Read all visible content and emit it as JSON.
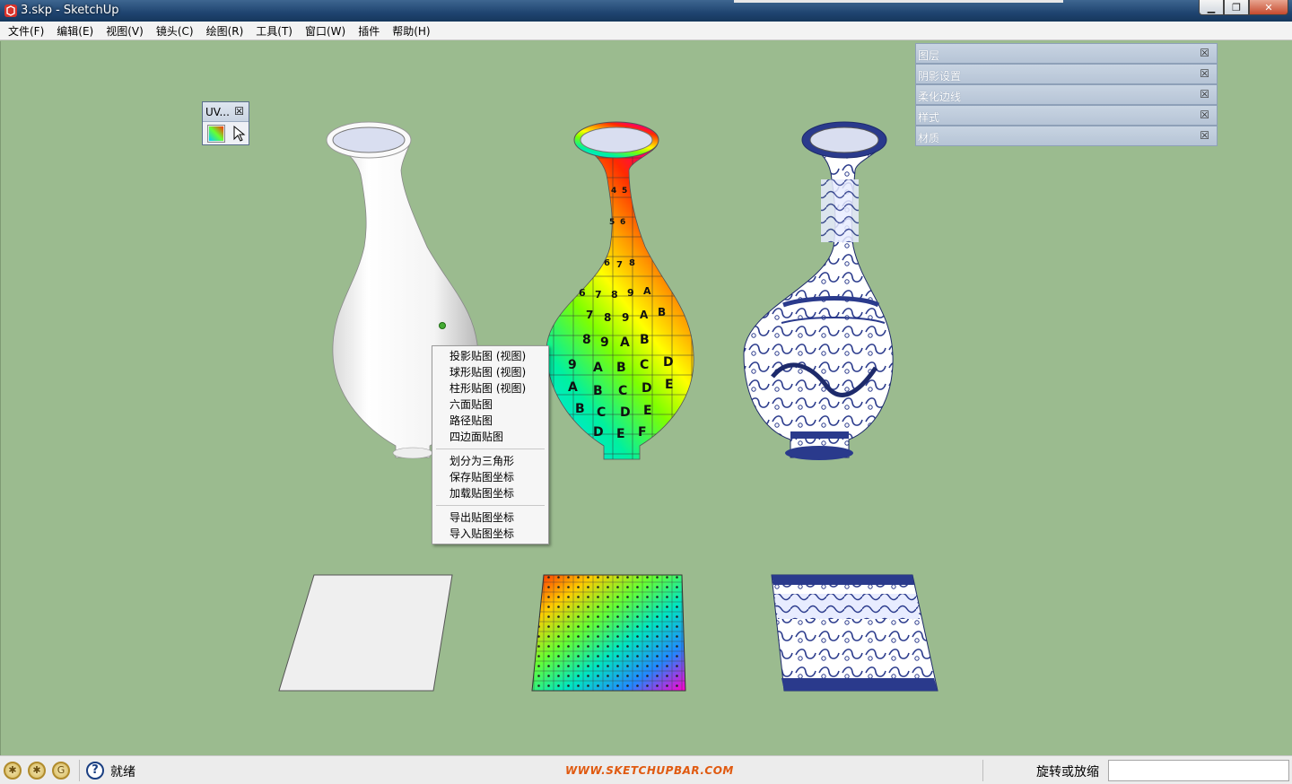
{
  "window": {
    "title": "3.skp - SketchUp",
    "controls": [
      "minimize",
      "maximize",
      "close"
    ]
  },
  "menubar": {
    "items": [
      "文件(F)",
      "编辑(E)",
      "视图(V)",
      "镜头(C)",
      "绘图(R)",
      "工具(T)",
      "窗口(W)",
      "插件",
      "帮助(H)"
    ]
  },
  "uv_toolbar": {
    "title": "UV...",
    "close": "☒",
    "tools": [
      "uv-texture-icon",
      "uv-pointer-icon"
    ]
  },
  "trays": [
    {
      "label": "图层"
    },
    {
      "label": "阴影设置"
    },
    {
      "label": "柔化边线"
    },
    {
      "label": "样式"
    },
    {
      "label": "材质"
    }
  ],
  "context_menu": {
    "group1": [
      "投影贴图 (视图)",
      "球形贴图 (视图)",
      "柱形贴图 (视图)",
      "六面贴图",
      "路径贴图",
      "四边面贴图"
    ],
    "group2": [
      "划分为三角形",
      "保存贴图坐标",
      "加载贴图坐标"
    ],
    "group3": [
      "导出贴图坐标",
      "导入贴图坐标"
    ]
  },
  "scene": {
    "objects": [
      "white-vase",
      "uv-grid-vase",
      "blue-white-porcelain-vase",
      "white-plane",
      "uv-grid-plane",
      "porcelain-pattern-plane"
    ],
    "grid_letters": "0123456789ABCDEF"
  },
  "statusbar": {
    "status": "就绪",
    "watermark": "WWW.SKETCHUPBAR.COM",
    "measure_label": "旋转或放缩",
    "measure_value": ""
  },
  "colors": {
    "background": "#9bbb8f",
    "titlebar": "#1f4470",
    "porcelain_blue": "#2a3a8c"
  }
}
